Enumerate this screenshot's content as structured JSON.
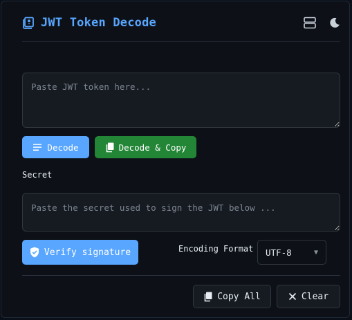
{
  "header": {
    "title": "JWT Token Decode",
    "logo_icon": "book-icon",
    "layout_icon": "layout-rows-icon",
    "theme_icon": "moon-icon"
  },
  "token_input": {
    "placeholder": "Paste JWT token here...",
    "value": ""
  },
  "actions": {
    "decode_label": "Decode",
    "decode_copy_label": "Decode & Copy"
  },
  "secret": {
    "label": "Secret",
    "placeholder": "Paste the secret used to sign the JWT below ...",
    "value": ""
  },
  "verify": {
    "label": "Verify signature"
  },
  "encoding": {
    "label": "Encoding Format",
    "selected": "UTF-8"
  },
  "footer": {
    "copy_all_label": "Copy All",
    "clear_label": "Clear"
  },
  "colors": {
    "accent": "#58a6ff",
    "success": "#238636",
    "background": "#0d1117"
  }
}
